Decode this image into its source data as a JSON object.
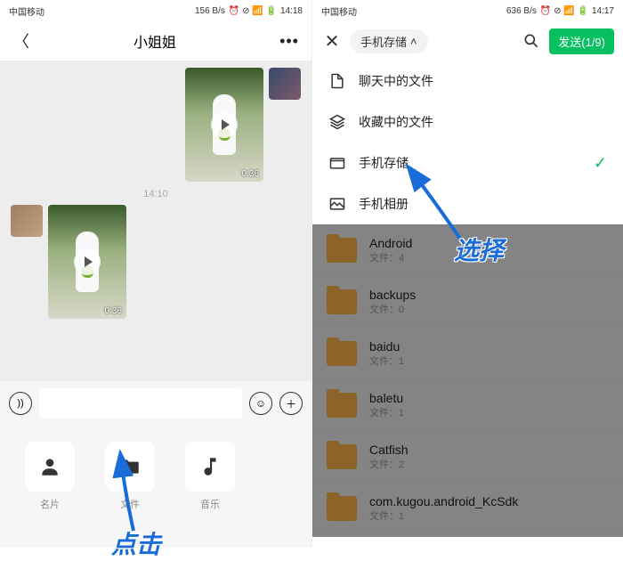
{
  "left": {
    "status": {
      "carrier": "中国移动",
      "net": "5G",
      "speed": "156 B/s",
      "time": "14:18",
      "icons": "⏰ ⊘ 📶 🔋"
    },
    "header": {
      "title": "小姐姐"
    },
    "messages": {
      "video_duration": "0:36",
      "timestamp": "14:10"
    },
    "attach": {
      "contact": "名片",
      "file": "文件",
      "music": "音乐"
    },
    "annotation": "点击"
  },
  "right": {
    "status": {
      "carrier": "中国移动",
      "net": "5G",
      "speed": "636 B/s",
      "time": "14:17",
      "icons": "⏰ ⊘ 📶 🔋"
    },
    "header": {
      "storage_pill": "手机存储",
      "send": "发送(1/9)"
    },
    "sources": {
      "chat_files": "聊天中的文件",
      "fav_files": "收藏中的文件",
      "phone_storage": "手机存储",
      "phone_album": "手机相册"
    },
    "folders": [
      {
        "name": "Android",
        "sub": "文件：4"
      },
      {
        "name": "backups",
        "sub": "文件：0"
      },
      {
        "name": "baidu",
        "sub": "文件：1"
      },
      {
        "name": "baletu",
        "sub": "文件：1"
      },
      {
        "name": "Catfish",
        "sub": "文件：2"
      },
      {
        "name": "com.kugou.android_KcSdk",
        "sub": "文件：1"
      }
    ],
    "annotation": "选择"
  }
}
